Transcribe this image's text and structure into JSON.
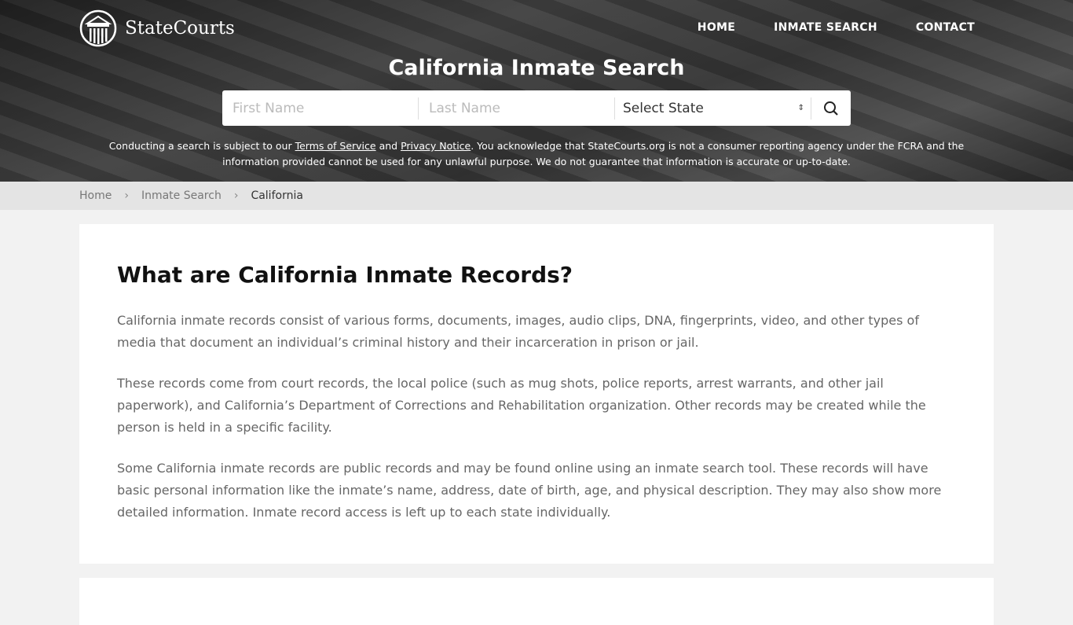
{
  "header": {
    "logo": "StateCourts",
    "nav": [
      "HOME",
      "INMATE SEARCH",
      "CONTACT"
    ]
  },
  "hero": {
    "title": "California Inmate Search",
    "search": {
      "first_placeholder": "First Name",
      "last_placeholder": "Last Name",
      "state_value": "Select State"
    },
    "disclaimer": {
      "pre": "Conducting a search is subject to our ",
      "tos": "Terms of Service",
      "and": " and ",
      "privacy": "Privacy Notice",
      "post": ". You acknowledge that StateCourts.org is not a consumer reporting agency under the FCRA and the information provided cannot be used for any unlawful purpose. We do not guarantee that information is accurate or up-to-date."
    }
  },
  "breadcrumb": [
    "Home",
    "Inmate Search",
    "California"
  ],
  "main": {
    "heading": "What are California Inmate Records?",
    "paragraphs": [
      "California inmate records consist of various forms, documents, images, audio clips, DNA, fingerprints, video, and other types of media that document an individual’s criminal history and their incarceration in prison or jail.",
      "These records come from court records, the local police (such as mug shots, police reports, arrest warrants, and other jail paperwork), and California’s Department of Corrections and Rehabilitation organization. Other records may be created while the person is held in a specific facility.",
      "Some California inmate records are public records and may be found online using an inmate search tool. These records will have basic personal information like the inmate’s name, address, date of birth, age, and physical description. They may also show more detailed information. Inmate record access is left up to each state individually."
    ]
  }
}
